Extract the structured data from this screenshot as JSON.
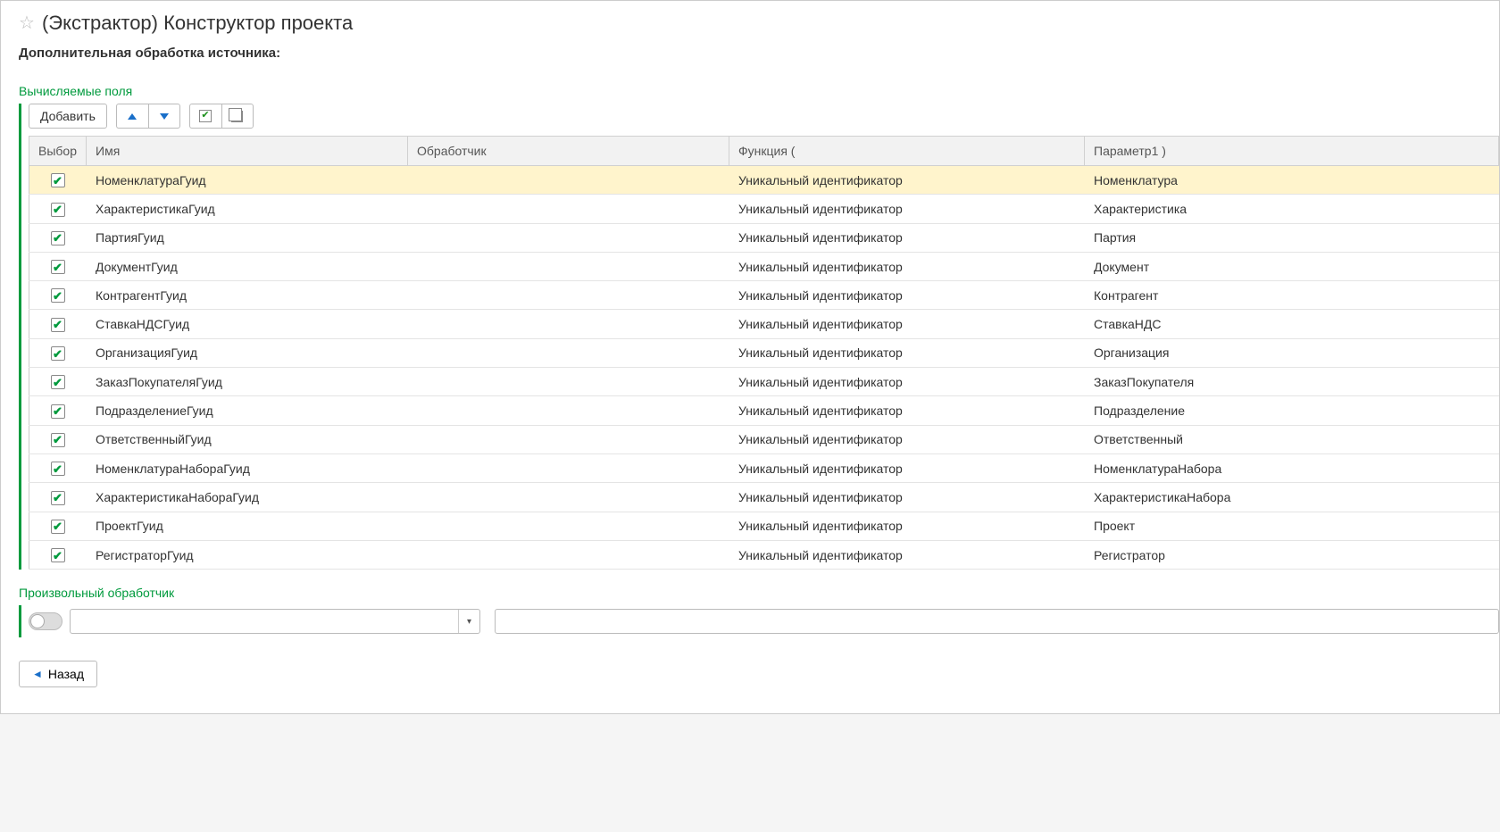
{
  "title": "(Экстрактор) Конструктор проекта",
  "subtitle": "Дополнительная обработка источника:",
  "section_computed": "Вычисляемые поля",
  "toolbar": {
    "add_label": "Добавить"
  },
  "columns": {
    "select": "Выбор",
    "name": "Имя",
    "handler": "Обработчик",
    "func": "Функция (",
    "param1": "Параметр1 )"
  },
  "rows": [
    {
      "checked": true,
      "name": "НоменклатураГуид",
      "handler": "",
      "func": "Уникальный идентификатор",
      "param1": "Номенклатура",
      "selected": true
    },
    {
      "checked": true,
      "name": "ХарактеристикаГуид",
      "handler": "",
      "func": "Уникальный идентификатор",
      "param1": "Характеристика",
      "selected": false
    },
    {
      "checked": true,
      "name": "ПартияГуид",
      "handler": "",
      "func": "Уникальный идентификатор",
      "param1": "Партия",
      "selected": false
    },
    {
      "checked": true,
      "name": "ДокументГуид",
      "handler": "",
      "func": "Уникальный идентификатор",
      "param1": "Документ",
      "selected": false
    },
    {
      "checked": true,
      "name": "КонтрагентГуид",
      "handler": "",
      "func": "Уникальный идентификатор",
      "param1": "Контрагент",
      "selected": false
    },
    {
      "checked": true,
      "name": "СтавкаНДСГуид",
      "handler": "",
      "func": "Уникальный идентификатор",
      "param1": "СтавкаНДС",
      "selected": false
    },
    {
      "checked": true,
      "name": "ОрганизацияГуид",
      "handler": "",
      "func": "Уникальный идентификатор",
      "param1": "Организация",
      "selected": false
    },
    {
      "checked": true,
      "name": "ЗаказПокупателяГуид",
      "handler": "",
      "func": "Уникальный идентификатор",
      "param1": "ЗаказПокупателя",
      "selected": false
    },
    {
      "checked": true,
      "name": "ПодразделениеГуид",
      "handler": "",
      "func": "Уникальный идентификатор",
      "param1": "Подразделение",
      "selected": false
    },
    {
      "checked": true,
      "name": "ОтветственныйГуид",
      "handler": "",
      "func": "Уникальный идентификатор",
      "param1": "Ответственный",
      "selected": false
    },
    {
      "checked": true,
      "name": "НоменклатураНабораГуид",
      "handler": "",
      "func": "Уникальный идентификатор",
      "param1": "НоменклатураНабора",
      "selected": false
    },
    {
      "checked": true,
      "name": "ХарактеристикаНабораГуид",
      "handler": "",
      "func": "Уникальный идентификатор",
      "param1": "ХарактеристикаНабора",
      "selected": false
    },
    {
      "checked": true,
      "name": "ПроектГуид",
      "handler": "",
      "func": "Уникальный идентификатор",
      "param1": "Проект",
      "selected": false
    },
    {
      "checked": true,
      "name": "РегистраторГуид",
      "handler": "",
      "func": "Уникальный идентификатор",
      "param1": "Регистратор",
      "selected": false
    }
  ],
  "section_handler": "Произвольный обработчик",
  "handler_toggle": false,
  "handler_dropdown": "",
  "handler_text": "",
  "back_label": "Назад"
}
